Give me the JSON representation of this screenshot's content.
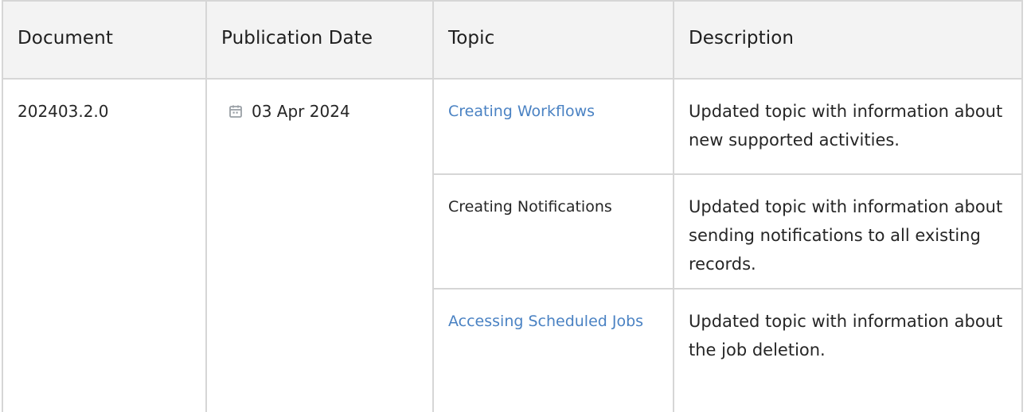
{
  "table": {
    "headers": [
      "Document",
      "Publication Date",
      "Topic",
      "Description"
    ],
    "document": "202403.2.0",
    "publication_date": "03 Apr 2024",
    "rows": [
      {
        "topic": "Creating Workflows",
        "topic_is_link": true,
        "description": "Updated topic with information about new supported activities."
      },
      {
        "topic": "Creating Notifications",
        "topic_is_link": false,
        "description": "Updated topic with information about sending notifications to all existing records."
      },
      {
        "topic": "Accessing Scheduled Jobs",
        "topic_is_link": true,
        "description": "Updated topic with information about the job deletion."
      }
    ]
  },
  "colors": {
    "link": "#4a82c3",
    "header_bg": "#f3f3f3",
    "border": "#d6d6d6",
    "icon": "#9aa0a6"
  },
  "icons": {
    "date": "calendar-icon"
  }
}
